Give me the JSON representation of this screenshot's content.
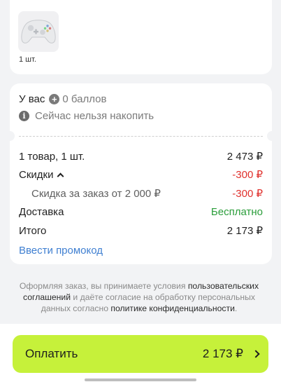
{
  "product": {
    "quantity_label": "1 шт."
  },
  "bonus": {
    "prefix": "У вас",
    "points": "0 баллов",
    "cannot_accumulate": "Сейчас нельзя накопить"
  },
  "summary": {
    "items_label": "1 товар, 1 шт.",
    "items_value": "2 473 ₽",
    "discounts_label": "Скидки",
    "discounts_value": "-300 ₽",
    "order_discount_label": "Скидка за заказ от 2 000 ₽",
    "order_discount_value": "-300 ₽",
    "delivery_label": "Доставка",
    "delivery_value": "Бесплатно",
    "total_label": "Итого",
    "total_value": "2 173 ₽",
    "promo_link": "Ввести промокод"
  },
  "legal": {
    "part1": "Оформляя заказ, вы принимаете условия ",
    "link1": "пользовательских соглашений",
    "part2": " и даёте согласие на обработку персональных данных согласно ",
    "link2": "политике конфиденциальности",
    "part3": "."
  },
  "pay_button": {
    "label": "Оплатить",
    "amount": "2 173 ₽"
  },
  "colors": {
    "accent": "#c6f13a",
    "negative": "#e0312d",
    "free": "#2a9d3a",
    "link": "#3f7fd1"
  },
  "icons": [
    "gamepad-product-image",
    "plus-circle-icon",
    "info-icon",
    "chevron-up-icon",
    "chevron-right-icon"
  ]
}
